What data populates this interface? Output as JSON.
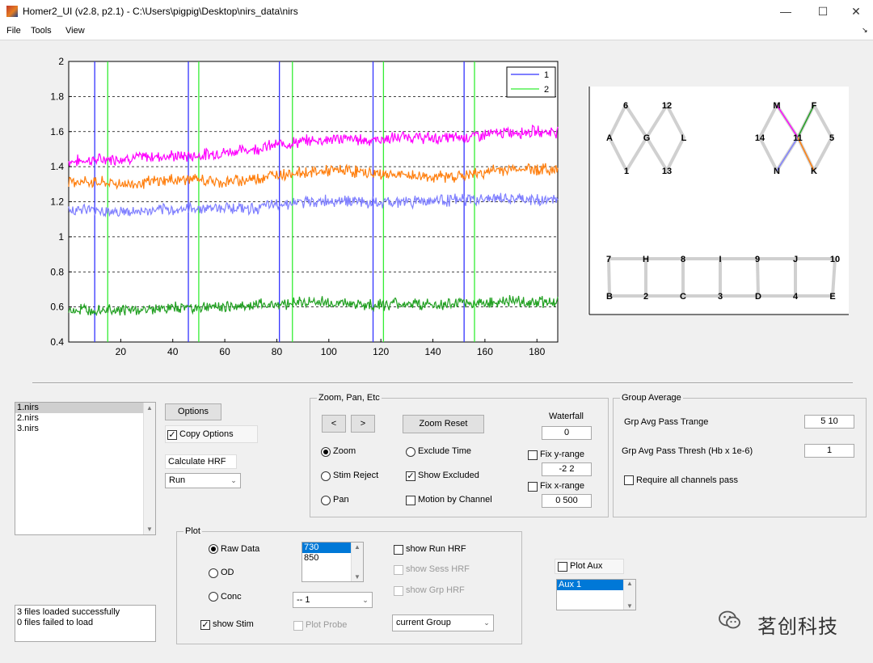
{
  "window": {
    "title": "Homer2_UI  (v2.8, p2.1) - C:\\Users\\pigpig\\Desktop\\nirs_data\\nirs",
    "minimize": "—",
    "maximize": "☐",
    "close": "✕"
  },
  "menu": {
    "file": "File",
    "tools": "Tools",
    "view": "View",
    "corner": "↘"
  },
  "chart_data": {
    "type": "line",
    "xlim": [
      0,
      188
    ],
    "ylim": [
      0.4,
      2
    ],
    "x_ticks": [
      "20",
      "40",
      "60",
      "80",
      "100",
      "120",
      "140",
      "160",
      "180"
    ],
    "y_ticks": [
      "0.4",
      "0.6",
      "0.8",
      "1",
      "1.2",
      "1.4",
      "1.6",
      "1.8",
      "2"
    ],
    "grid": "dashed horizontal",
    "legend_position": "top-right",
    "legend": [
      {
        "name": "1",
        "color": "#3333ff"
      },
      {
        "name": "2",
        "color": "#33ee33"
      }
    ],
    "stim_lines_1": [
      10,
      46,
      81,
      117,
      152
    ],
    "stim_lines_2": [
      15,
      50,
      86,
      121,
      156
    ],
    "series": [
      {
        "color": "#ff00ff",
        "values": [
          1.43,
          1.44,
          1.45,
          1.46,
          1.46,
          1.48,
          1.5,
          1.53,
          1.55,
          1.56,
          1.55,
          1.57,
          1.56,
          1.57,
          1.59,
          1.6,
          1.6
        ]
      },
      {
        "color": "#ff7f0e",
        "values": [
          1.32,
          1.31,
          1.3,
          1.32,
          1.33,
          1.31,
          1.33,
          1.36,
          1.37,
          1.38,
          1.36,
          1.35,
          1.34,
          1.35,
          1.38,
          1.39,
          1.38
        ]
      },
      {
        "color": "#7f7fff",
        "values": [
          1.16,
          1.15,
          1.14,
          1.15,
          1.16,
          1.17,
          1.16,
          1.19,
          1.2,
          1.21,
          1.19,
          1.2,
          1.21,
          1.21,
          1.22,
          1.21,
          1.21
        ]
      },
      {
        "color": "#22a022",
        "values": [
          0.58,
          0.59,
          0.58,
          0.59,
          0.6,
          0.6,
          0.61,
          0.62,
          0.63,
          0.62,
          0.61,
          0.62,
          0.61,
          0.62,
          0.63,
          0.63,
          0.63
        ]
      }
    ]
  },
  "probe": {
    "nodes": [
      {
        "t": "6",
        "c": [
          774,
          130
        ]
      },
      {
        "t": "12",
        "c": [
          825,
          130
        ]
      },
      {
        "t": "A",
        "c": [
          754,
          170
        ]
      },
      {
        "t": "G",
        "c": [
          800,
          170
        ]
      },
      {
        "t": "L",
        "c": [
          846,
          170
        ]
      },
      {
        "t": "1",
        "c": [
          775,
          211
        ]
      },
      {
        "t": "13",
        "c": [
          825,
          211
        ]
      },
      {
        "t": "M",
        "c": [
          961,
          130
        ]
      },
      {
        "t": "F",
        "c": [
          1007,
          130
        ]
      },
      {
        "t": "14",
        "c": [
          940,
          170
        ]
      },
      {
        "t": "11",
        "c": [
          987,
          170
        ]
      },
      {
        "t": "5",
        "c": [
          1029,
          170
        ]
      },
      {
        "t": "N",
        "c": [
          961,
          211
        ]
      },
      {
        "t": "K",
        "c": [
          1007,
          211
        ]
      },
      {
        "t": "7",
        "c": [
          753,
          320
        ]
      },
      {
        "t": "H",
        "c": [
          799,
          320
        ]
      },
      {
        "t": "8",
        "c": [
          845,
          320
        ]
      },
      {
        "t": "I",
        "c": [
          891,
          320
        ]
      },
      {
        "t": "9",
        "c": [
          937,
          320
        ]
      },
      {
        "t": "J",
        "c": [
          984,
          320
        ]
      },
      {
        "t": "10",
        "c": [
          1033,
          320
        ]
      },
      {
        "t": "B",
        "c": [
          754,
          366
        ]
      },
      {
        "t": "2",
        "c": [
          799,
          366
        ]
      },
      {
        "t": "C",
        "c": [
          845,
          366
        ]
      },
      {
        "t": "3",
        "c": [
          891,
          366
        ]
      },
      {
        "t": "D",
        "c": [
          938,
          366
        ]
      },
      {
        "t": "4",
        "c": [
          984,
          366
        ]
      },
      {
        "t": "E",
        "c": [
          1030,
          366
        ]
      }
    ]
  },
  "files": {
    "items": [
      "1.nirs",
      "2.nirs",
      "3.nirs"
    ],
    "status1": "3 files loaded successfully",
    "status2": "0 files failed to load"
  },
  "options": {
    "options_button": "Options",
    "copy_options": "Copy Options",
    "calc_hrf": "Calculate HRF",
    "run_select": "Run"
  },
  "zoom": {
    "title": "Zoom, Pan, Etc",
    "prev": "<",
    "next": ">",
    "zoom_reset": "Zoom Reset",
    "waterfall": "Waterfall",
    "waterfall_value": "0",
    "zoom": "Zoom",
    "stim_reject": "Stim Reject",
    "pan": "Pan",
    "exclude_time": "Exclude Time",
    "show_excluded": "Show Excluded",
    "motion_by_channel": "Motion by Channel",
    "fix_y": "Fix y-range",
    "y_range": "-2 2",
    "fix_x": "Fix x-range",
    "x_range": "0 500"
  },
  "group": {
    "title": "Group Average",
    "trange_label": "Grp Avg Pass Trange",
    "trange_value": "5 10",
    "thresh_label": "Grp Avg Pass Thresh (Hb x 1e-6)",
    "thresh_value": "1",
    "require_all": "Require all channels pass"
  },
  "plot": {
    "title": "Plot",
    "raw": "Raw Data",
    "od": "OD",
    "conc": "Conc",
    "wavelengths": [
      "730",
      "850"
    ],
    "select_value": "-- 1",
    "show_run_hrf": "show Run HRF",
    "show_sess_hrf": "show Sess HRF",
    "show_grp_hrf": "show Grp HRF",
    "show_stim": "show Stim",
    "plot_probe": "Plot Probe",
    "group_select": "current Group"
  },
  "aux": {
    "plot_aux": "Plot Aux",
    "items": [
      "Aux 1"
    ]
  },
  "watermark": "茗创科技",
  "colors": {
    "accent_selection": "#0078d7",
    "list_highlight": "#cfcfcf"
  }
}
